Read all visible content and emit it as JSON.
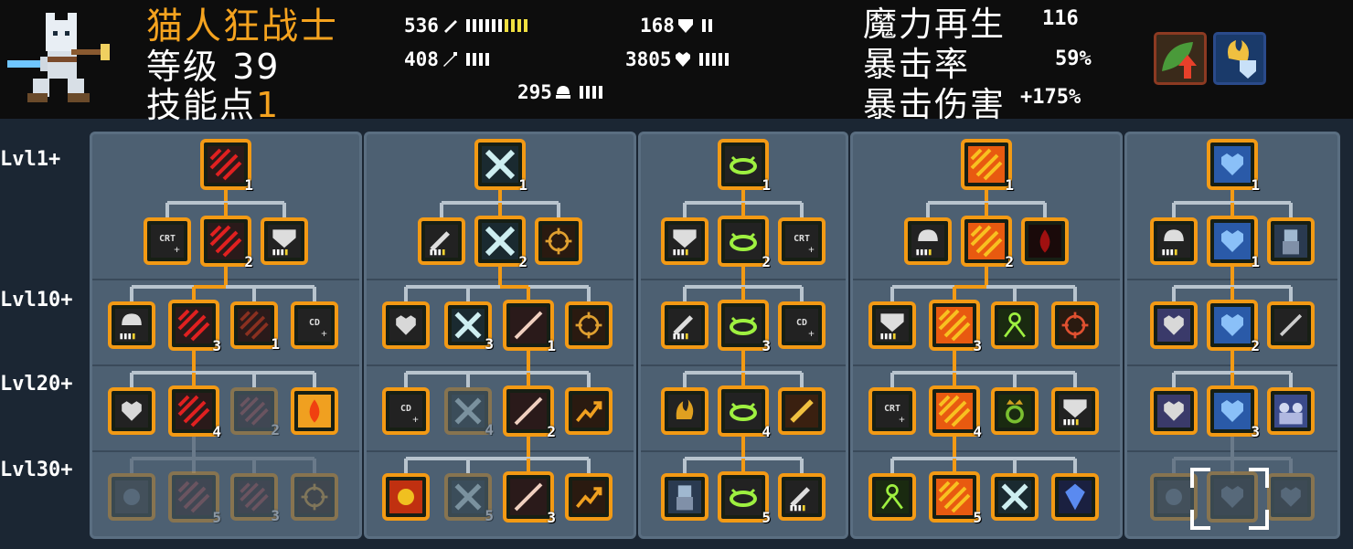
{
  "character": {
    "name": "猫人狂战士",
    "level_label": "等级 39",
    "skill_points_label": "技能点",
    "skill_points_value": "1"
  },
  "stats": {
    "attack": "536",
    "defense": "168",
    "magic": "408",
    "health": "3805",
    "speed": "295"
  },
  "right_stats": [
    {
      "label": "魔力再生",
      "value": "116"
    },
    {
      "label": "暴击率",
      "value": "59%"
    },
    {
      "label": "暴击伤害",
      "value": "+175%"
    }
  ],
  "buffs": [
    {
      "name": "leaf-attack-buff-icon",
      "color": "#3f8a3a"
    },
    {
      "name": "fire-shield-buff-icon",
      "color": "#2a5fa8"
    }
  ],
  "row_labels": [
    "Lvl1+",
    "Lvl10+",
    "Lvl20+",
    "Lvl30+"
  ],
  "colors": {
    "accent": "#f39a14",
    "panel": "#4d6072",
    "header": "#0d0d0d"
  },
  "trees": [
    {
      "root": {
        "icon": "red-claw-icon",
        "level": "1"
      },
      "rows": [
        [
          {
            "icon": "crit-plus-icon",
            "level": ""
          },
          {
            "icon": "red-claw-icon",
            "level": "2"
          },
          {
            "icon": "armor-meter-icon",
            "level": ""
          }
        ],
        [
          {
            "icon": "helmet-meter-icon",
            "level": ""
          },
          {
            "icon": "red-claw-icon",
            "level": "3"
          },
          {
            "icon": "dark-claw-icon",
            "level": "1"
          },
          {
            "icon": "cooldown-plus-icon",
            "level": ""
          }
        ],
        [
          {
            "icon": "heart-shield-icon",
            "level": ""
          },
          {
            "icon": "red-claw-icon",
            "level": "4"
          },
          {
            "icon": "faded-claw-icon",
            "level": "2"
          },
          {
            "icon": "fire-drop-icon",
            "level": ""
          }
        ],
        [
          {
            "icon": "faded-armor-icon",
            "level": ""
          },
          {
            "icon": "faded-claw-icon",
            "level": "5"
          },
          {
            "icon": "faded-claw-icon",
            "level": "3"
          },
          {
            "icon": "faded-target-icon",
            "level": ""
          }
        ]
      ]
    },
    {
      "root": {
        "icon": "cross-blade-icon",
        "level": "1"
      },
      "rows": [
        [
          {
            "icon": "sword-meter-icon",
            "level": ""
          },
          {
            "icon": "cross-blade-icon",
            "level": "2"
          },
          {
            "icon": "target-icon",
            "level": ""
          }
        ],
        [
          {
            "icon": "heart-meter-icon",
            "level": ""
          },
          {
            "icon": "cross-blade-icon",
            "level": "3"
          },
          {
            "icon": "slash-icon",
            "level": "1"
          },
          {
            "icon": "target-icon",
            "level": ""
          }
        ],
        [
          {
            "icon": "cooldown-plus-icon",
            "level": ""
          },
          {
            "icon": "faded-cross-icon",
            "level": "4"
          },
          {
            "icon": "slash-icon",
            "level": "2"
          },
          {
            "icon": "rising-arrow-icon",
            "level": ""
          }
        ],
        [
          {
            "icon": "explosion-icon",
            "level": ""
          },
          {
            "icon": "faded-cross-icon",
            "level": "5"
          },
          {
            "icon": "slash-icon",
            "level": "3"
          },
          {
            "icon": "rising-arrow-icon",
            "level": ""
          }
        ]
      ]
    },
    {
      "root": {
        "icon": "green-halo-icon",
        "level": "1"
      },
      "rows": [
        [
          {
            "icon": "armor-meter-icon",
            "level": ""
          },
          {
            "icon": "green-halo-icon",
            "level": "2"
          },
          {
            "icon": "crit-plus-icon",
            "level": ""
          }
        ],
        [
          {
            "icon": "sword-meter-icon",
            "level": ""
          },
          {
            "icon": "green-halo-icon",
            "level": "3"
          },
          {
            "icon": "cooldown-plus-icon",
            "level": ""
          }
        ],
        [
          {
            "icon": "fire-cat-icon",
            "level": ""
          },
          {
            "icon": "green-halo-icon",
            "level": "4"
          },
          {
            "icon": "gold-blade-icon",
            "level": ""
          }
        ],
        [
          {
            "icon": "knight-icon",
            "level": ""
          },
          {
            "icon": "green-halo-icon",
            "level": "5"
          },
          {
            "icon": "sword-meter-icon",
            "level": ""
          }
        ]
      ]
    },
    {
      "root": {
        "icon": "fire-claw-icon",
        "level": "1"
      },
      "rows": [
        [
          {
            "icon": "helmet-timer-icon",
            "level": ""
          },
          {
            "icon": "fire-claw-icon",
            "level": "2"
          },
          {
            "icon": "blood-drop-icon",
            "level": ""
          }
        ],
        [
          {
            "icon": "armor-meter-icon",
            "level": ""
          },
          {
            "icon": "fire-claw-icon",
            "level": "3"
          },
          {
            "icon": "green-compass-icon",
            "level": ""
          },
          {
            "icon": "red-target-icon",
            "level": ""
          }
        ],
        [
          {
            "icon": "crit-plus-icon",
            "level": ""
          },
          {
            "icon": "fire-claw-icon",
            "level": "4"
          },
          {
            "icon": "crown-ring-icon",
            "level": ""
          },
          {
            "icon": "armor-meter-icon",
            "level": ""
          }
        ],
        [
          {
            "icon": "green-compass-icon",
            "level": ""
          },
          {
            "icon": "fire-claw-icon",
            "level": "5"
          },
          {
            "icon": "crossed-swords-icon",
            "level": ""
          },
          {
            "icon": "blue-gem-icon",
            "level": ""
          }
        ]
      ]
    },
    {
      "root": {
        "icon": "blue-heart-icon",
        "level": "1"
      },
      "rows": [
        [
          {
            "icon": "helmet-meter-icon",
            "level": ""
          },
          {
            "icon": "blue-heart-icon",
            "level": "1"
          },
          {
            "icon": "knight-sword-icon",
            "level": ""
          }
        ],
        [
          {
            "icon": "gear-heart-icon",
            "level": ""
          },
          {
            "icon": "blue-heart-icon",
            "level": "2"
          },
          {
            "icon": "dark-sword-icon",
            "level": ""
          }
        ],
        [
          {
            "icon": "gear-heart-icon",
            "level": ""
          },
          {
            "icon": "blue-heart-icon",
            "level": "3"
          },
          {
            "icon": "ghost-army-icon",
            "level": ""
          }
        ],
        [
          {
            "icon": "faded-ring-icon",
            "level": ""
          },
          {
            "icon": "faded-heart-icon",
            "level": ""
          },
          {
            "icon": "faded-heart-icon",
            "level": ""
          }
        ]
      ]
    }
  ]
}
